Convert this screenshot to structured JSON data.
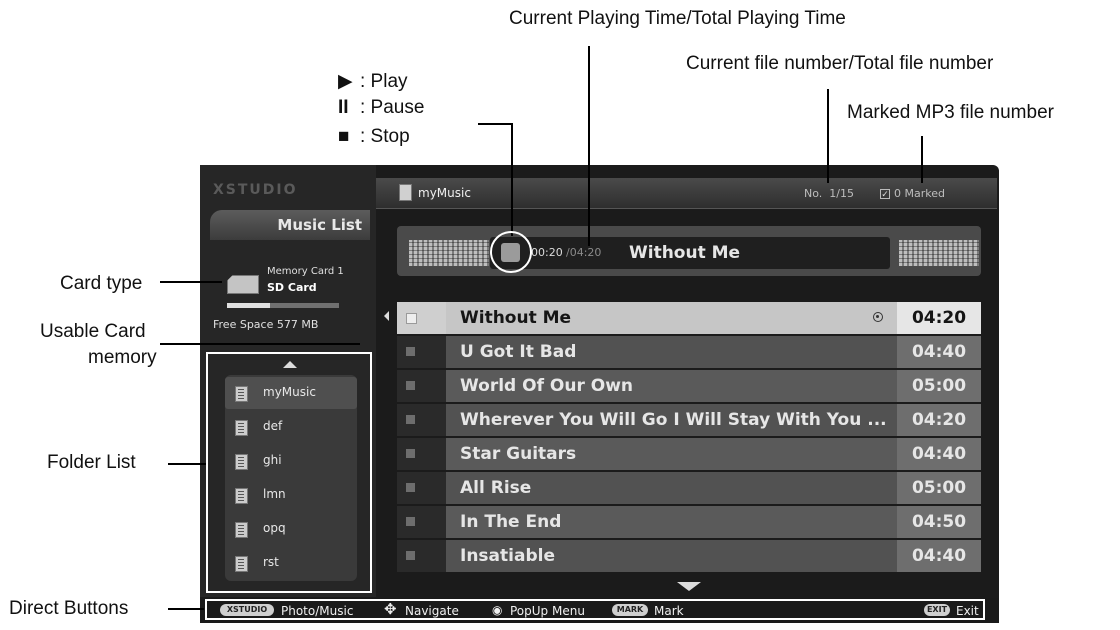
{
  "callouts": {
    "playing_time": "Current Playing Time/Total Playing Time",
    "file_number": "Current file number/Total file number",
    "marked": "Marked MP3 file number",
    "card_type": "Card type",
    "usable_line1": "Usable Card",
    "usable_line2": "memory",
    "folder_list": "Folder List",
    "direct_buttons": "Direct Buttons"
  },
  "legend": [
    {
      "symbol": "▶",
      "label": ": Play"
    },
    {
      "symbol": "II",
      "label": ": Pause"
    },
    {
      "symbol": "■",
      "label": ": Stop"
    }
  ],
  "screen": {
    "brand": "XSTUDIO",
    "tab": "Music List",
    "folder_title": "myMusic",
    "file_no": "No.  1/15",
    "marked": "0 Marked",
    "card_name": "Memory Card 1",
    "card_type": "SD Card",
    "free_space": "Free Space 577 MB",
    "free_fraction": 0.38,
    "current_time": "00:20",
    "total_time": "/04:20",
    "now_title": "Without Me"
  },
  "folders": [
    "myMusic",
    "def",
    "ghi",
    "lmn",
    "opq",
    "rst"
  ],
  "tracks": [
    {
      "title": "Without Me",
      "duration": "04:20"
    },
    {
      "title": "U Got It Bad",
      "duration": "04:40"
    },
    {
      "title": "World Of Our Own",
      "duration": "05:00"
    },
    {
      "title": "Wherever You Will Go I Will Stay With You ...",
      "duration": "04:20"
    },
    {
      "title": "Star Guitars",
      "duration": "04:40"
    },
    {
      "title": "All Rise",
      "duration": "05:00"
    },
    {
      "title": "In The End",
      "duration": "04:50"
    },
    {
      "title": "Insatiable",
      "duration": "04:40"
    }
  ],
  "bottom_bar": {
    "xstudio_key": "XSTUDIO",
    "photo_music": "Photo/Music",
    "navigate": "Navigate",
    "popup": "PopUp Menu",
    "mark_key": "MARK",
    "mark": "Mark",
    "exit_key": "EXIT",
    "exit": "Exit"
  },
  "colors": {
    "selected_row": "#c6c6c6",
    "row": "#5a5a5a",
    "row_alt": "#525252",
    "duration_cell": "#6e6e6e",
    "screen_bg": "#1b1b1b"
  }
}
